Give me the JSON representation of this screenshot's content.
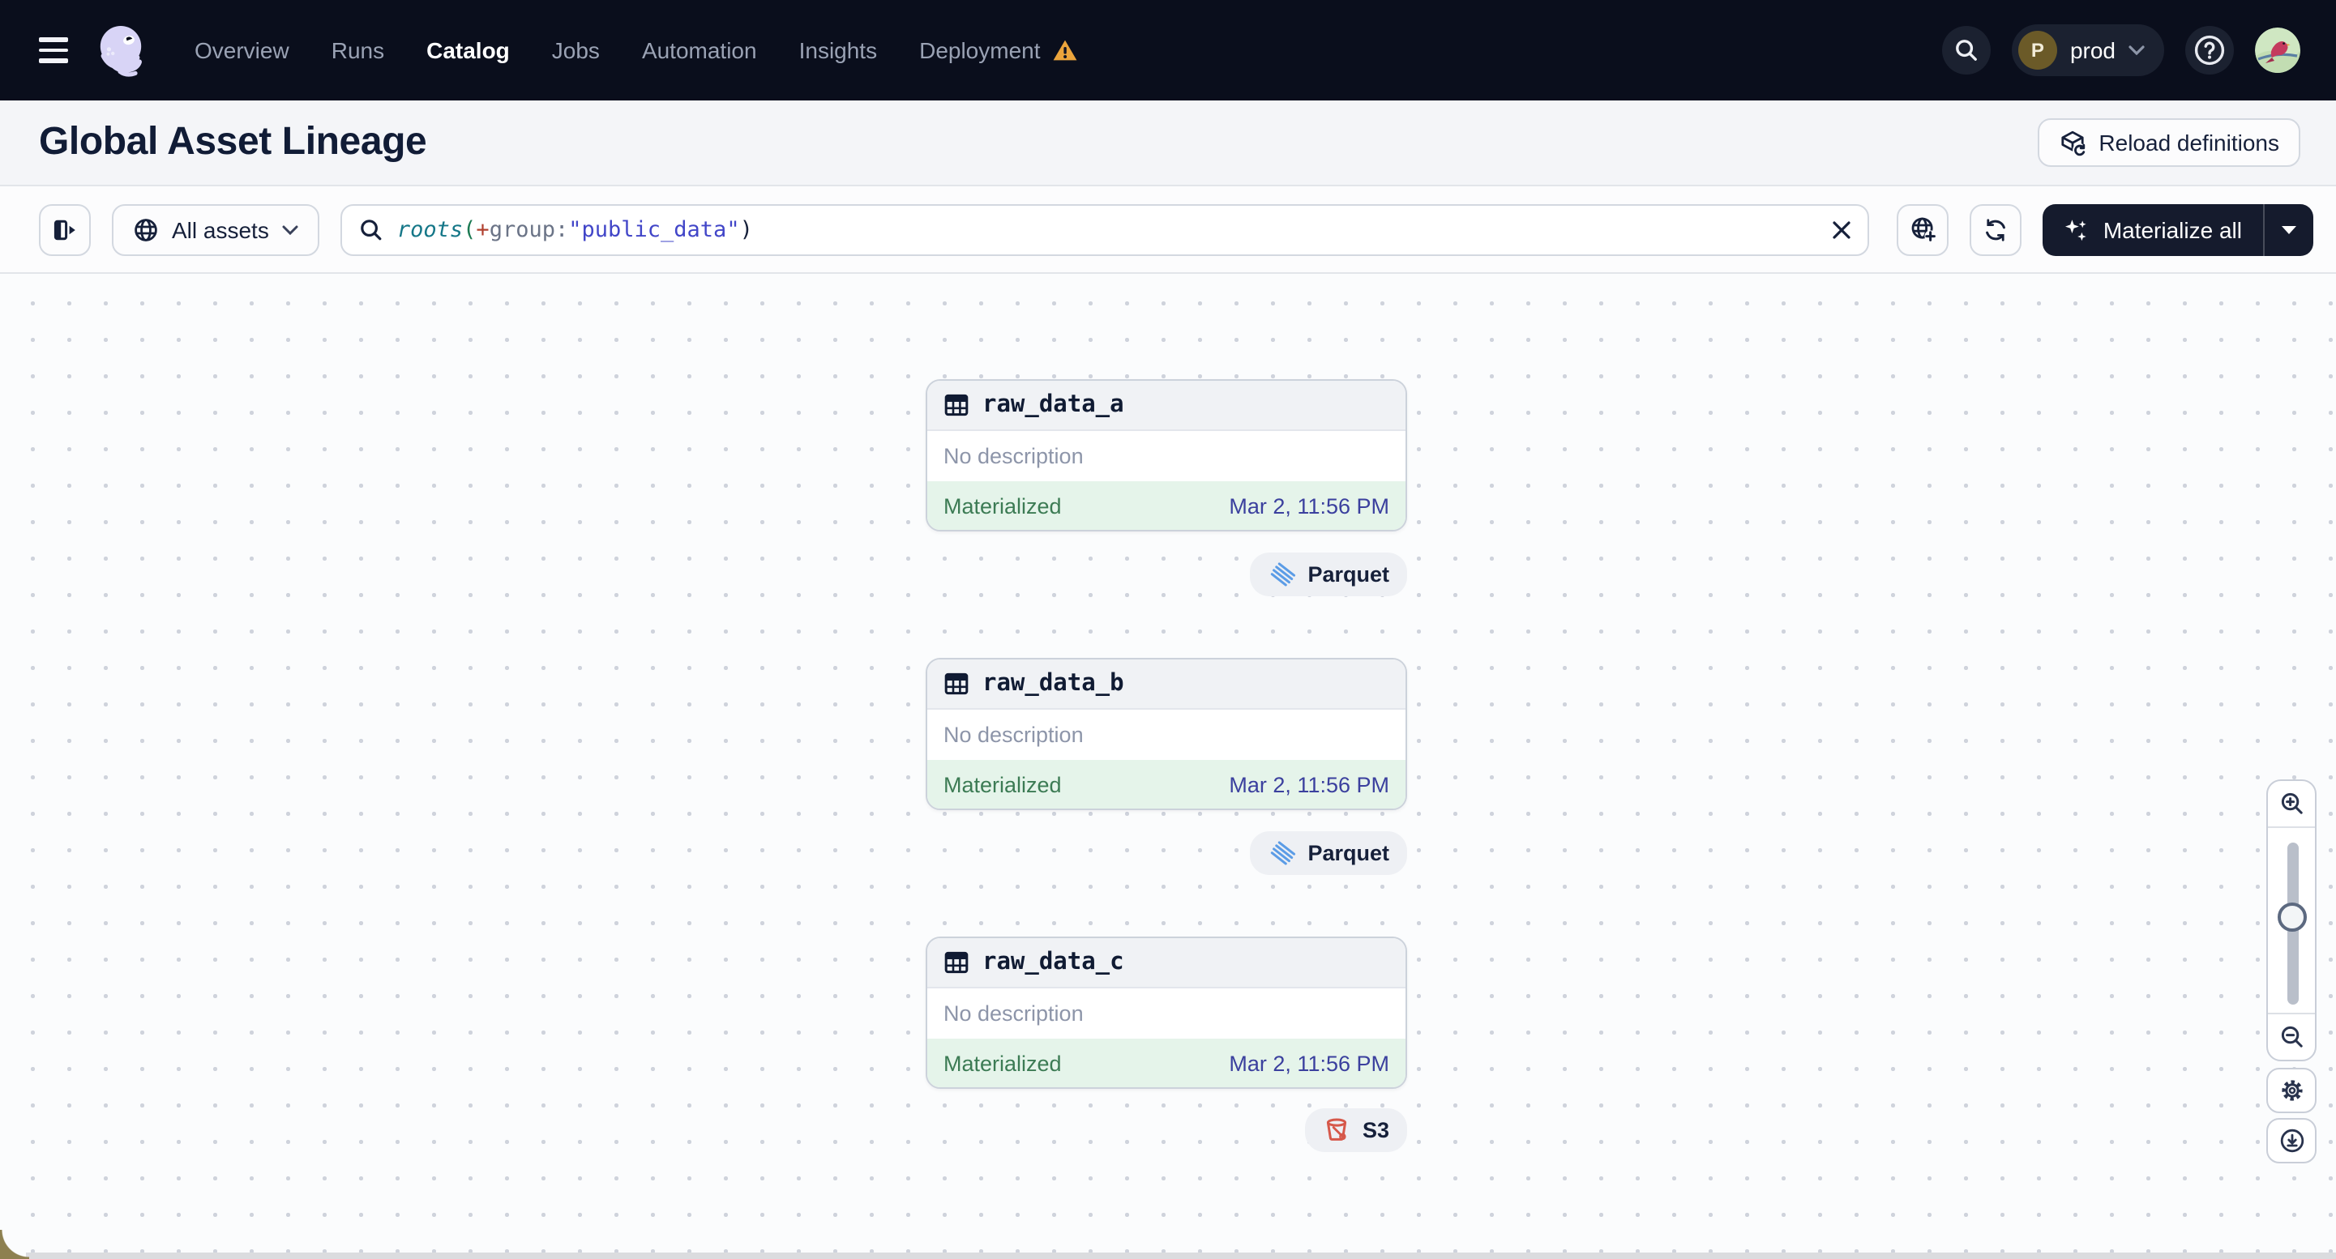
{
  "nav": {
    "items": [
      "Overview",
      "Runs",
      "Catalog",
      "Jobs",
      "Automation",
      "Insights",
      "Deployment"
    ],
    "active_item": "Catalog",
    "deployment_has_warning": true,
    "environment": {
      "initial": "P",
      "label": "prod"
    }
  },
  "header": {
    "title": "Global Asset Lineage",
    "reload_button_label": "Reload definitions"
  },
  "toolbar": {
    "scope_button_label": "All assets",
    "query_tokens": [
      "roots",
      "(",
      "+",
      "group:",
      "\"public_data\"",
      ")"
    ],
    "materialize_button_label": "Materialize all"
  },
  "canvas": {
    "nodes": [
      {
        "name": "raw_data_a",
        "description": "No description",
        "status": "Materialized",
        "timestamp": "Mar 2, 11:56 PM",
        "tag": "Parquet"
      },
      {
        "name": "raw_data_b",
        "description": "No description",
        "status": "Materialized",
        "timestamp": "Mar 2, 11:56 PM",
        "tag": "Parquet"
      },
      {
        "name": "raw_data_c",
        "description": "No description",
        "status": "Materialized",
        "timestamp": "Mar 2, 11:56 PM",
        "tag": "S3"
      }
    ],
    "controls": [
      "zoom-in-icon",
      "zoom-slider",
      "zoom-out-icon",
      "settings-gear-icon",
      "download-icon"
    ]
  },
  "colors": {
    "nav_bg": "#0a0e1c",
    "materialize_bg": "#151b2d",
    "status_green": "#3c7b54",
    "status_bg_green": "#e5f4ea",
    "timestamp_blue": "#3b409e",
    "parquet_blue": "#5b9ce6",
    "s3_red": "#d6584a",
    "warning_orange": "#eba43c",
    "query_function_teal": "#157788",
    "query_string_indigo": "#4246c8"
  }
}
